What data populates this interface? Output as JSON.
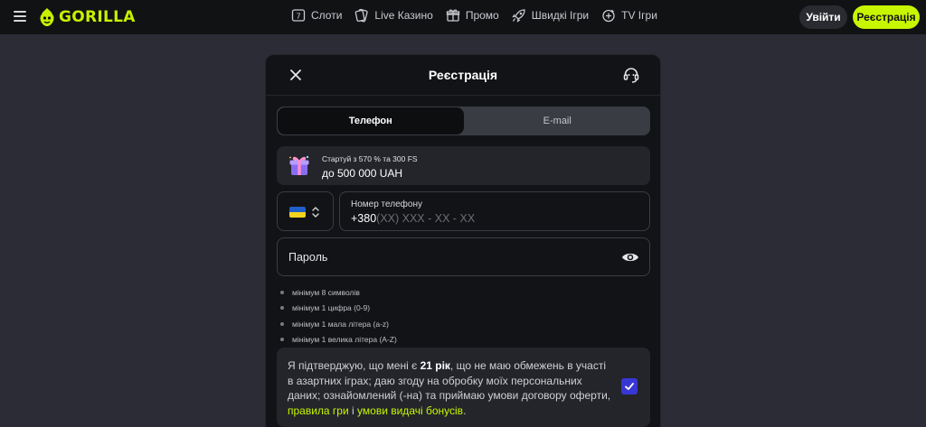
{
  "header": {
    "logo_text": "GORILLA",
    "nav": [
      {
        "label": "Слоти",
        "icon": "slots-icon"
      },
      {
        "label": "Live Казино",
        "icon": "live-casino-icon"
      },
      {
        "label": "Промо",
        "icon": "gift-icon"
      },
      {
        "label": "Швидкі Ігри",
        "icon": "rocket-icon"
      },
      {
        "label": "TV Ігри",
        "icon": "tv-games-icon"
      }
    ],
    "login_label": "Увійти",
    "register_label": "Реєстрація",
    "accent_color": "#c8f500"
  },
  "modal": {
    "title": "Реєстрація",
    "tabs": [
      {
        "label": "Телефон",
        "active": true
      },
      {
        "label": "E-mail",
        "active": false
      }
    ],
    "promo": {
      "subtitle": "Стартуй з 570 % та 300 FS",
      "main": "до 500 000 UAH"
    },
    "country": {
      "flag": "Ukraine"
    },
    "phone": {
      "label": "Номер телефону",
      "prefix": "+380",
      "mask": "(XX) XXX - XX - XX"
    },
    "password": {
      "placeholder": "Пароль"
    },
    "rules": [
      "мінімум 8 символів",
      "мінімум 1 цифра (0-9)",
      "мінімум 1 мала літера (a-z)",
      "мінімум 1 велика літера (A-Z)"
    ],
    "consent": {
      "text_before": "Я підтверджую, що мені є ",
      "age": "21 рік",
      "text_middle": ", що не маю обмежень в участі в азартних іграх; даю згоду на обробку моїх персональних даних; ознайомлений (-на) та приймаю умови договору оферти, ",
      "link1": "правила гри",
      "and": " і ",
      "link2": "умови видачі бонусів",
      "end": ".",
      "checked": true,
      "checkbox_color": "#3837d6"
    }
  }
}
